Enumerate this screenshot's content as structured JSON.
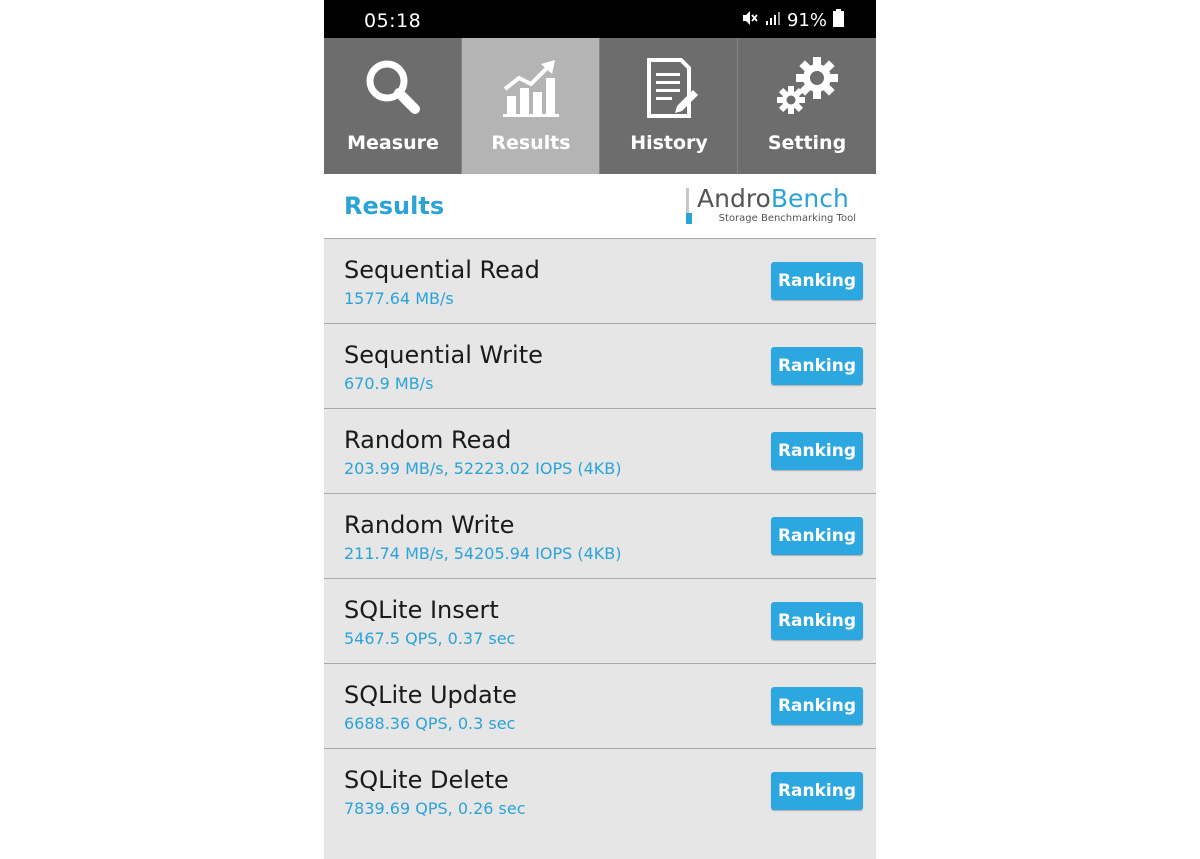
{
  "status_bar": {
    "time": "05:18",
    "battery": "91%",
    "icons": [
      "mute-icon",
      "signal-icon",
      "battery-icon"
    ]
  },
  "tabs": [
    {
      "label": "Measure",
      "icon": "magnifier-icon",
      "active": false
    },
    {
      "label": "Results",
      "icon": "chart-icon",
      "active": true
    },
    {
      "label": "History",
      "icon": "document-icon",
      "active": false
    },
    {
      "label": "Setting",
      "icon": "gears-icon",
      "active": false
    }
  ],
  "header": {
    "title": "Results",
    "logo": {
      "name_part1": "Andro",
      "name_part2": "Bench",
      "tagline": "Storage Benchmarking Tool"
    }
  },
  "results": [
    {
      "name": "Sequential Read",
      "value": "1577.64 MB/s",
      "button": "Ranking"
    },
    {
      "name": "Sequential Write",
      "value": "670.9 MB/s",
      "button": "Ranking"
    },
    {
      "name": "Random Read",
      "value": "203.99 MB/s, 52223.02 IOPS (4KB)",
      "button": "Ranking"
    },
    {
      "name": "Random Write",
      "value": "211.74 MB/s, 54205.94 IOPS (4KB)",
      "button": "Ranking"
    },
    {
      "name": "SQLite Insert",
      "value": "5467.5 QPS, 0.37 sec",
      "button": "Ranking"
    },
    {
      "name": "SQLite Update",
      "value": "6688.36 QPS, 0.3 sec",
      "button": "Ranking"
    },
    {
      "name": "SQLite Delete",
      "value": "7839.69 QPS, 0.26 sec",
      "button": "Ranking"
    }
  ],
  "colors": {
    "accent": "#2ba3d8",
    "tab_bg": "#6d6d6d",
    "tab_active_bg": "#b4b4b4",
    "row_bg": "#e6e6e6"
  }
}
